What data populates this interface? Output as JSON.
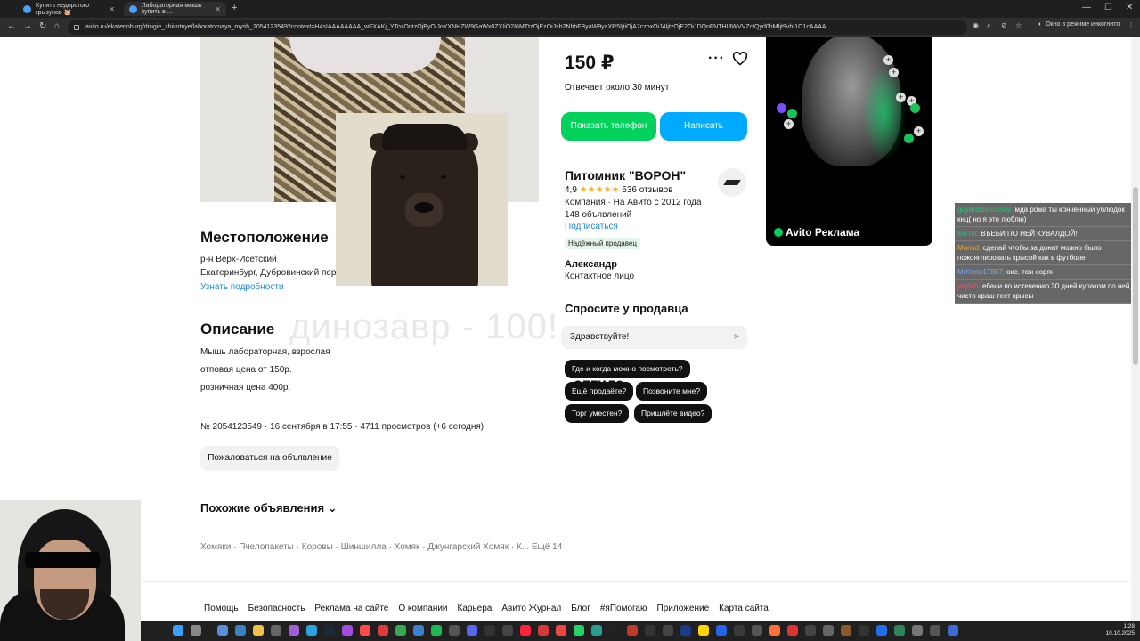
{
  "browser": {
    "tabs": [
      {
        "label": "Купить недорогого грызунов 🐹",
        "active": false
      },
      {
        "label": "Лабораторная мышь купить в ...",
        "active": true
      }
    ],
    "url": "avito.ru/ekaterinburg/drugie_zhivotnye/laboratornaya_mysh_2054123549?context=H4sIAAAAAAAA_wFXAKj_YTozOntzOjEyOiJoYXNHZW9GaWx0ZXIiO2I6MTtzOjEzOiJsb2NhbFByaW9yaXR5IjtiOjA7czoxOiJ4IjtzOjE2OiJDQnFNTHI3WVVZcIQyd0hMIjt9vbI1O1cAAAA",
    "incognito_label": "Окно в режиме инкогнито"
  },
  "listing": {
    "price": "150 ₽",
    "response_time": "Отвечает около 30 минут",
    "phone_button": "Показать телефон",
    "write_button": "Написать",
    "location_title": "Местоположение",
    "district": "р-н Верх-Исетский",
    "address": "Екатеринбург, Дубровинский пер",
    "learn_more": "Узнать подробности",
    "description_title": "Описание",
    "description_lines": [
      "Мышь лабораторная, взрослая",
      "отповая цена от 150р.",
      "розничная цена 400р."
    ],
    "meta": "№ 2054123549 · 16 сентября в 17:55 · 4711 просмотров (+6 сегодня)",
    "complain_button": "Пожаловаться на объявление",
    "similar_title": "Похожие объявления",
    "categories": "Хомяки · Пчелопакеты · Коровы · Шиншилла · Хомяк · Джунгарский Хомяк · К... Ещё 14"
  },
  "seller": {
    "name": "Питомник \"ВОРОН\"",
    "rating": "4,9",
    "stars": "★★★★★",
    "reviews": "536 отзывов",
    "company_line": "Компания · На Авито с 2012 года",
    "ads_count": "148 объявлений",
    "subscribe": "Подписаться",
    "badge": "Надёжный продавец",
    "contact_name": "Александр",
    "contact_role": "Контактное лицо"
  },
  "ask": {
    "title": "Спросите у продавца",
    "input_value": "Здравствуйте!",
    "chips": [
      "Где и когда можно посмотреть?",
      "Ещё продаёте?",
      "Позвоните мне?",
      "Торг уместен?",
      "Пришлёте видео?"
    ]
  },
  "ad": {
    "label": "Avito Реклама"
  },
  "stream_overlay": {
    "big_text": "динозавр - 100!",
    "small_text": "оптила"
  },
  "chat": [
    {
      "user": "goyardlovecchay:",
      "user_color": "#2ec27e",
      "text": "мда рома ты конченный ублюдок кнц( но я это люблю)"
    },
    {
      "user": "MeTot:",
      "user_color": "#2ec27e",
      "text": "ВЪЕБИ ПО НЕЙ КУВАЛДОЙ!"
    },
    {
      "user": "Morisd:",
      "user_color": "#f5a623",
      "text": "сделай чтобы за донат можно было пожонглировать крысой как в футболе"
    },
    {
      "user": "MrKroto17887:",
      "user_color": "#6fa8ff",
      "text": "оке. тож сорян"
    },
    {
      "user": "yayMh:",
      "user_color": "#ff4d6d",
      "text": "ебани по истечению 30 дней кулаком по ней, чисто краш тест крысы"
    }
  ],
  "footer": [
    "Помощь",
    "Безопасность",
    "Реклама на сайте",
    "О компании",
    "Карьера",
    "Авито Журнал",
    "Блог",
    "#яПомогаю",
    "Приложение",
    "Карта сайта"
  ],
  "taskbar": {
    "time": "1:28",
    "date": "10.10.2025"
  },
  "colors": {
    "green": "#02d15c",
    "blue": "#00aaff",
    "link": "#1e88e5"
  }
}
